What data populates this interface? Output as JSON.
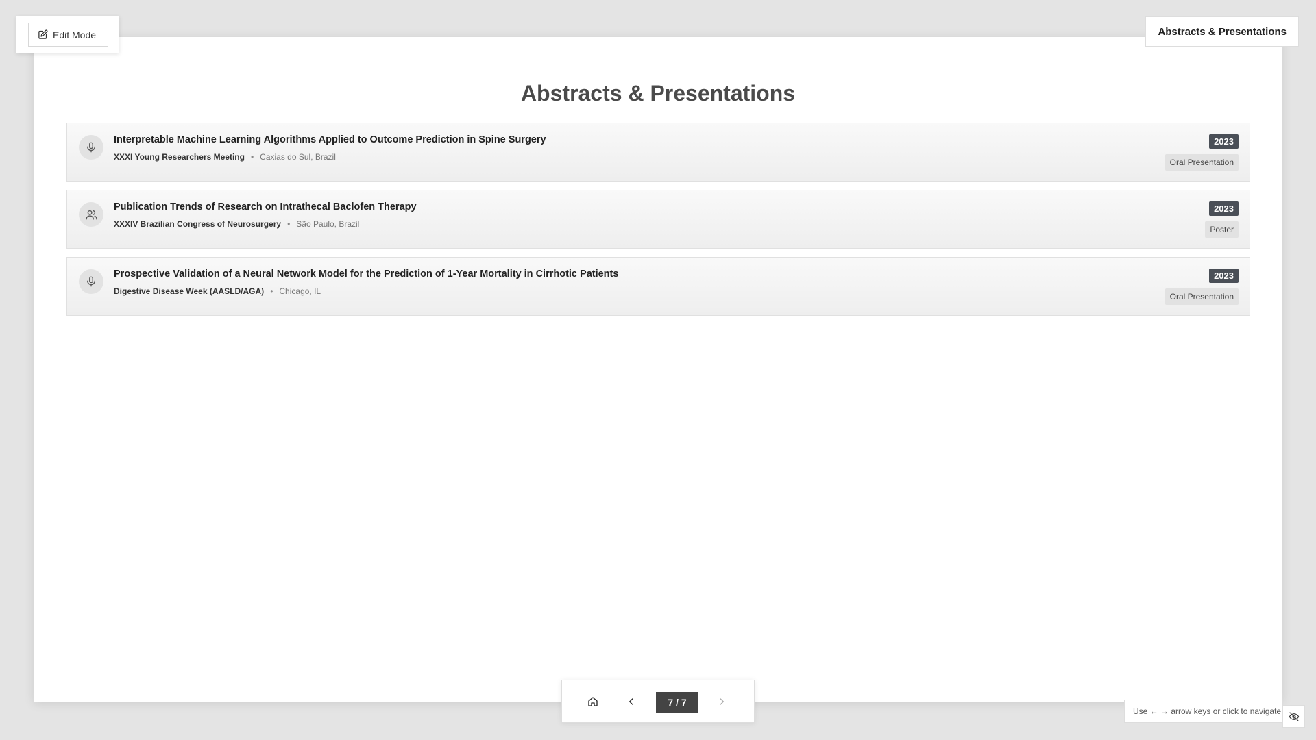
{
  "toolbar": {
    "edit_label": "Edit Mode"
  },
  "header": {
    "section_tag": "Abstracts & Presentations"
  },
  "slide": {
    "title": "Abstracts & Presentations",
    "entries": [
      {
        "icon": "microphone-icon",
        "title": "Interpretable Machine Learning Algorithms Applied to Outcome Prediction in Spine Surgery",
        "venue": "XXXI Young Researchers Meeting",
        "separator": "•",
        "location": "Caxias do Sul, Brazil",
        "year": "2023",
        "type": "Oral Presentation"
      },
      {
        "icon": "users-icon",
        "title": "Publication Trends of Research on Intrathecal Baclofen Therapy",
        "venue": "XXXIV Brazilian Congress of Neurosurgery",
        "separator": "•",
        "location": "São Paulo, Brazil",
        "year": "2023",
        "type": "Poster"
      },
      {
        "icon": "microphone-icon",
        "title": "Prospective Validation of a Neural Network Model for the Prediction of 1-Year Mortality in Cirrhotic Patients",
        "venue": "Digestive Disease Week (AASLD/AGA)",
        "separator": "•",
        "location": "Chicago, IL",
        "year": "2023",
        "type": "Oral Presentation"
      }
    ]
  },
  "navigation": {
    "counter": "7 / 7",
    "hint": "Use ← → arrow keys or click to navigate",
    "icons": [
      "home-icon",
      "chevron-left-icon",
      "chevron-right-icon",
      "eye-off-icon"
    ]
  },
  "colors": {
    "page_background": "#e4e4e4",
    "year_badge": "#4a4f57",
    "counter_badge": "#444444",
    "type_badge": "#e2e2e2"
  }
}
